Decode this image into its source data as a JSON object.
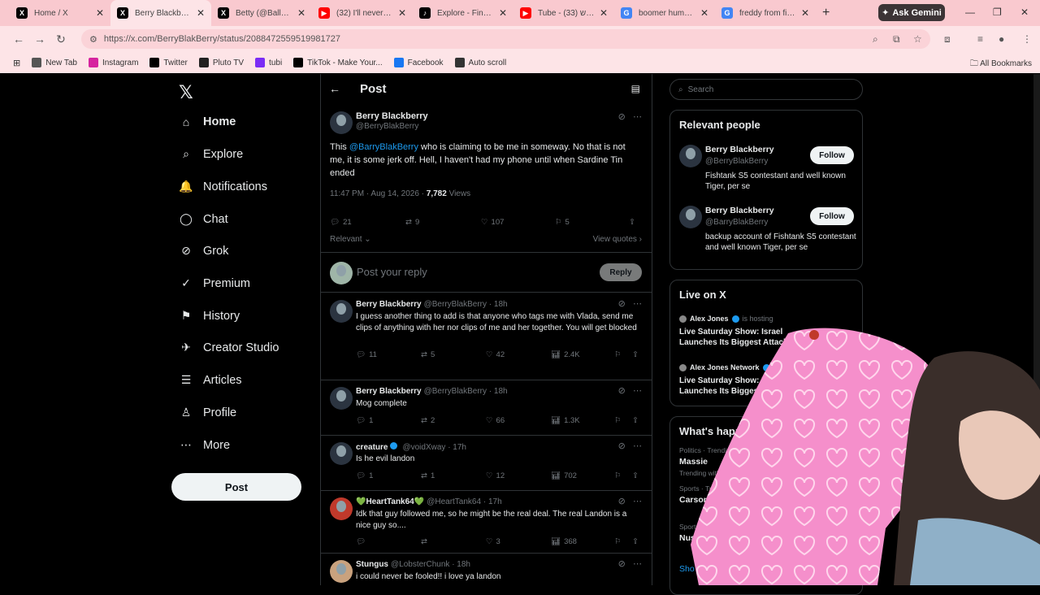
{
  "browser": {
    "tabs": [
      {
        "title": "Home / X",
        "icon": "x-icon",
        "color": "#000000",
        "active": false
      },
      {
        "title": "Berry Blackberry on X",
        "icon": "x-icon",
        "color": "#000000",
        "active": true
      },
      {
        "title": "Betty (@Ballerina...",
        "icon": "x-icon",
        "color": "#000000",
        "active": false
      },
      {
        "title": "(32) I'll never lie a...",
        "icon": "youtube-icon",
        "color": "#ff0000",
        "active": false
      },
      {
        "title": "Explore - Find you...",
        "icon": "tiktok-icon",
        "color": "#000000",
        "active": false
      },
      {
        "title": "Tube - שטשש (33)",
        "icon": "youtube-icon",
        "color": "#ff0000",
        "active": false
      },
      {
        "title": "boomer humor - ...",
        "icon": "google-icon",
        "color": "#4285f4",
        "active": false
      },
      {
        "title": "freddy from fishta...",
        "icon": "google-icon",
        "color": "#4285f4",
        "active": false
      }
    ],
    "gemini_label": "Ask Gemini",
    "url": "https://x.com/BerryBlakBerry/status/2088472559519981727",
    "bookmarks": [
      {
        "label": "New Tab",
        "icon": "globe-icon",
        "color": "#555555"
      },
      {
        "label": "Instagram",
        "icon": "instagram-icon",
        "color": "#d6249f"
      },
      {
        "label": "Twitter",
        "icon": "x-icon",
        "color": "#000000"
      },
      {
        "label": "Pluto TV",
        "icon": "pluto-icon",
        "color": "#222222"
      },
      {
        "label": "tubi",
        "icon": "tubi-icon",
        "color": "#7a2cf5"
      },
      {
        "label": "TikTok - Make Your...",
        "icon": "tiktok-icon",
        "color": "#000000"
      },
      {
        "label": "Facebook",
        "icon": "facebook-icon",
        "color": "#1877f2"
      },
      {
        "label": "Auto scroll",
        "icon": "autoscroll-icon",
        "color": "#333333"
      }
    ],
    "all_bookmarks": "All Bookmarks"
  },
  "sidebar": {
    "items": [
      {
        "label": "Home",
        "icon": "⌂",
        "bold": true
      },
      {
        "label": "Explore",
        "icon": "⌕",
        "bold": false
      },
      {
        "label": "Notifications",
        "icon": "🔔",
        "bold": false
      },
      {
        "label": "Chat",
        "icon": "◯",
        "bold": false
      },
      {
        "label": "Grok",
        "icon": "⊘",
        "bold": false
      },
      {
        "label": "Premium",
        "icon": "✓",
        "bold": false
      },
      {
        "label": "History",
        "icon": "⚑",
        "bold": false
      },
      {
        "label": "Creator Studio",
        "icon": "✈",
        "bold": false
      },
      {
        "label": "Articles",
        "icon": "☰",
        "bold": false
      },
      {
        "label": "Profile",
        "icon": "♙",
        "bold": false
      },
      {
        "label": "More",
        "icon": "⋯",
        "bold": false
      }
    ],
    "post_label": "Post"
  },
  "main": {
    "header_title": "Post",
    "post": {
      "name": "Berry Blackberry",
      "handle": "@BerryBlakBerry",
      "text_before": "This ",
      "mention": "@BarryBlakBerry",
      "text_after": "  who is claiming to be me in someway. No that is not me, it is some jerk off. Hell, I haven't had my phone until when Sardine Tin ended",
      "time": "11:47 PM · Aug 14, 2026 · ",
      "views": "7,782",
      "views_label": " Views",
      "replies": "21",
      "reposts": "9",
      "likes": "107",
      "bookmarks": "5",
      "sort_label": "Relevant",
      "view_quotes": "View quotes"
    },
    "reply_placeholder": "Post your reply",
    "reply_button": "Reply",
    "replies": [
      {
        "name": "Berry Blackberry",
        "handle": "@BerryBlakBerry · 18h",
        "verified": false,
        "text": "I guess another thing to add is that anyone who tags me with Vlada, send me clips of anything with her nor clips of me and her together. You will get blocked",
        "replies": "11",
        "reposts": "5",
        "likes": "42",
        "views": "2.4K"
      },
      {
        "name": "Berry Blackberry",
        "handle": "@BerryBlakBerry · 18h",
        "verified": false,
        "text": "Mog complete",
        "replies": "1",
        "reposts": "2",
        "likes": "66",
        "views": "1.3K"
      },
      {
        "name": "creature",
        "handle": "@voidXway · 17h",
        "verified": true,
        "text": "Is he evil landon",
        "replies": "1",
        "reposts": "1",
        "likes": "12",
        "views": "702"
      },
      {
        "name": "💚HeartTank64💚",
        "handle": "@HeartTank64 · 17h",
        "verified": false,
        "text": "Idk that guy followed me, so he might be the real deal. The real Landon is a nice guy so....",
        "replies": "",
        "reposts": "",
        "likes": "3",
        "views": "368"
      },
      {
        "name": "Stungus",
        "handle": "@LobsterChunk · 18h",
        "verified": false,
        "text": "i could never be fooled!! i love ya landon",
        "replies": "",
        "reposts": "",
        "likes": "",
        "views": ""
      }
    ]
  },
  "right": {
    "search_placeholder": "Search",
    "relevant_title": "Relevant people",
    "people": [
      {
        "name": "Berry Blackberry",
        "handle": "@BerryBlakBerry",
        "bio": "Fishtank S5 contestant and well known Tiger, per se",
        "follow": "Follow"
      },
      {
        "name": "Berry Blackberry",
        "handle": "@BarryBlakBerry",
        "bio": "backup account of Fishtank S5 contestant and well known Tiger, per se",
        "follow": "Follow"
      }
    ],
    "live_title": "Live on X",
    "live": [
      {
        "host": "Alex Jones",
        "status": "is hosting",
        "title": "Live Saturday Show: Israel Launches Its Biggest Attack..."
      },
      {
        "host": "Alex Jones Network",
        "status": "is hosting",
        "title": "Live Saturday Show: Israel Launches Its Biggest Attack..."
      }
    ],
    "happening_title": "What's happening",
    "trends": [
      {
        "category": "Politics · Trending",
        "name": "Massie",
        "sub": "Trending with"
      },
      {
        "category": "Sports · Trending",
        "name": "Carson B"
      },
      {
        "category": "Sports · Trending",
        "name": "Nus"
      }
    ],
    "show_more": "Sho"
  }
}
